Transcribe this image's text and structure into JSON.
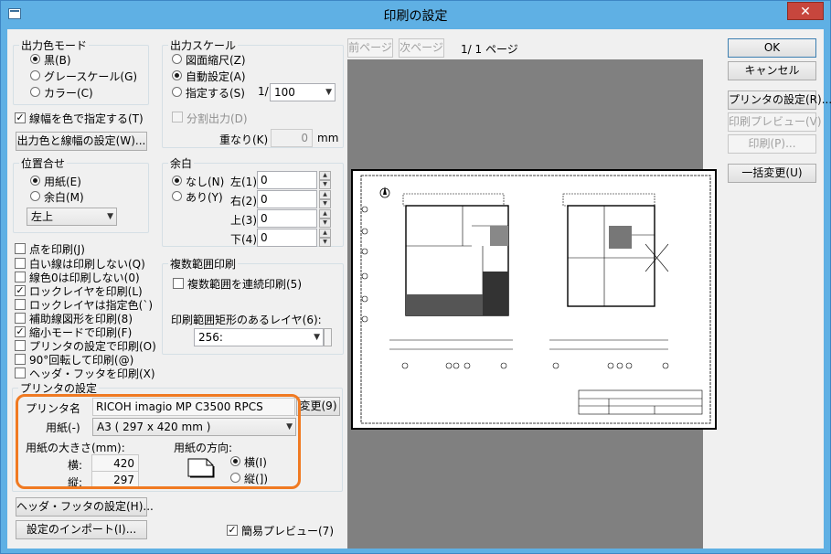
{
  "window": {
    "title": "印刷の設定",
    "close_glyph": "✕"
  },
  "output_color": {
    "legend": "出力色モード",
    "options": [
      "黒(B)",
      "グレースケール(G)",
      "カラー(C)"
    ],
    "selected": 0
  },
  "output_scale": {
    "legend": "出力スケール",
    "options": [
      "図面縮尺(Z)",
      "自動設定(A)",
      "指定する(S)"
    ],
    "selected": 1,
    "ratio_prefix": "1/",
    "ratio_value": "100",
    "split_label": "分割出力(D)",
    "overlap_label": "重なり(K)",
    "overlap_value": "0",
    "overlap_unit": "mm"
  },
  "line_color_check": {
    "label": "線幅を色で指定する(T)",
    "checked": true
  },
  "color_width_button": "出力色と線幅の設定(W)...",
  "alignment": {
    "legend": "位置合せ",
    "options": [
      "用紙(E)",
      "余白(M)"
    ],
    "selected": 0,
    "position_value": "左上"
  },
  "margin": {
    "legend": "余白",
    "options": [
      "なし(N)",
      "あり(Y)"
    ],
    "selected": 0,
    "fields": [
      {
        "label": "左(1)",
        "value": "0"
      },
      {
        "label": "右(2)",
        "value": "0"
      },
      {
        "label": "上(3)",
        "value": "0"
      },
      {
        "label": "下(4)",
        "value": "0"
      }
    ]
  },
  "options": [
    {
      "label": "点を印刷(J)",
      "checked": false
    },
    {
      "label": "白い線は印刷しない(Q)",
      "checked": false
    },
    {
      "label": "線色0は印刷しない(0)",
      "checked": false
    },
    {
      "label": "ロックレイヤを印刷(L)",
      "checked": true
    },
    {
      "label": "ロックレイヤは指定色(`)",
      "checked": false
    },
    {
      "label": "補助線図形を印刷(8)",
      "checked": false
    },
    {
      "label": "縮小モードで印刷(F)",
      "checked": true
    },
    {
      "label": "プリンタの設定で印刷(O)",
      "checked": false
    },
    {
      "label": "90°回転して印刷(@)",
      "checked": false
    },
    {
      "label": "ヘッダ・フッタを印刷(X)",
      "checked": false
    }
  ],
  "multi_range": {
    "legend": "複数範囲印刷",
    "continuous_label": "複数範囲を連続印刷(5)",
    "layer_label": "印刷範囲矩形のあるレイヤ(6):",
    "layer_value": "256:"
  },
  "printer": {
    "legend": "プリンタの設定",
    "name_label": "プリンタ名",
    "name_value": "RICOH imagio MP C3500 RPCS",
    "change_button": "変更(9)",
    "paper_label": "用紙(-)",
    "paper_value": "A3 ( 297 x 420 mm )",
    "size_label": "用紙の大きさ(mm):",
    "width_label": "横:",
    "width_value": "420",
    "height_label": "縦:",
    "height_value": "297",
    "orientation_label": "用紙の方向:",
    "orientation_options": [
      "横(I)",
      "縦(])"
    ],
    "orientation_selected": 0
  },
  "header_footer_button": "ヘッダ・フッタの設定(H)...",
  "import_button": "設定のインポート(I)...",
  "simple_preview": {
    "label": "簡易プレビュー(7)",
    "checked": true
  },
  "preview_nav": {
    "prev": "前ページ",
    "next": "次ページ",
    "page_info": "1/ 1 ページ"
  },
  "buttons": {
    "ok": "OK",
    "cancel": "キャンセル",
    "printer_settings": "プリンタの設定(R)...",
    "print_preview": "印刷プレビュー(V)",
    "print": "印刷(P)...",
    "batch_change": "一括変更(U)"
  }
}
